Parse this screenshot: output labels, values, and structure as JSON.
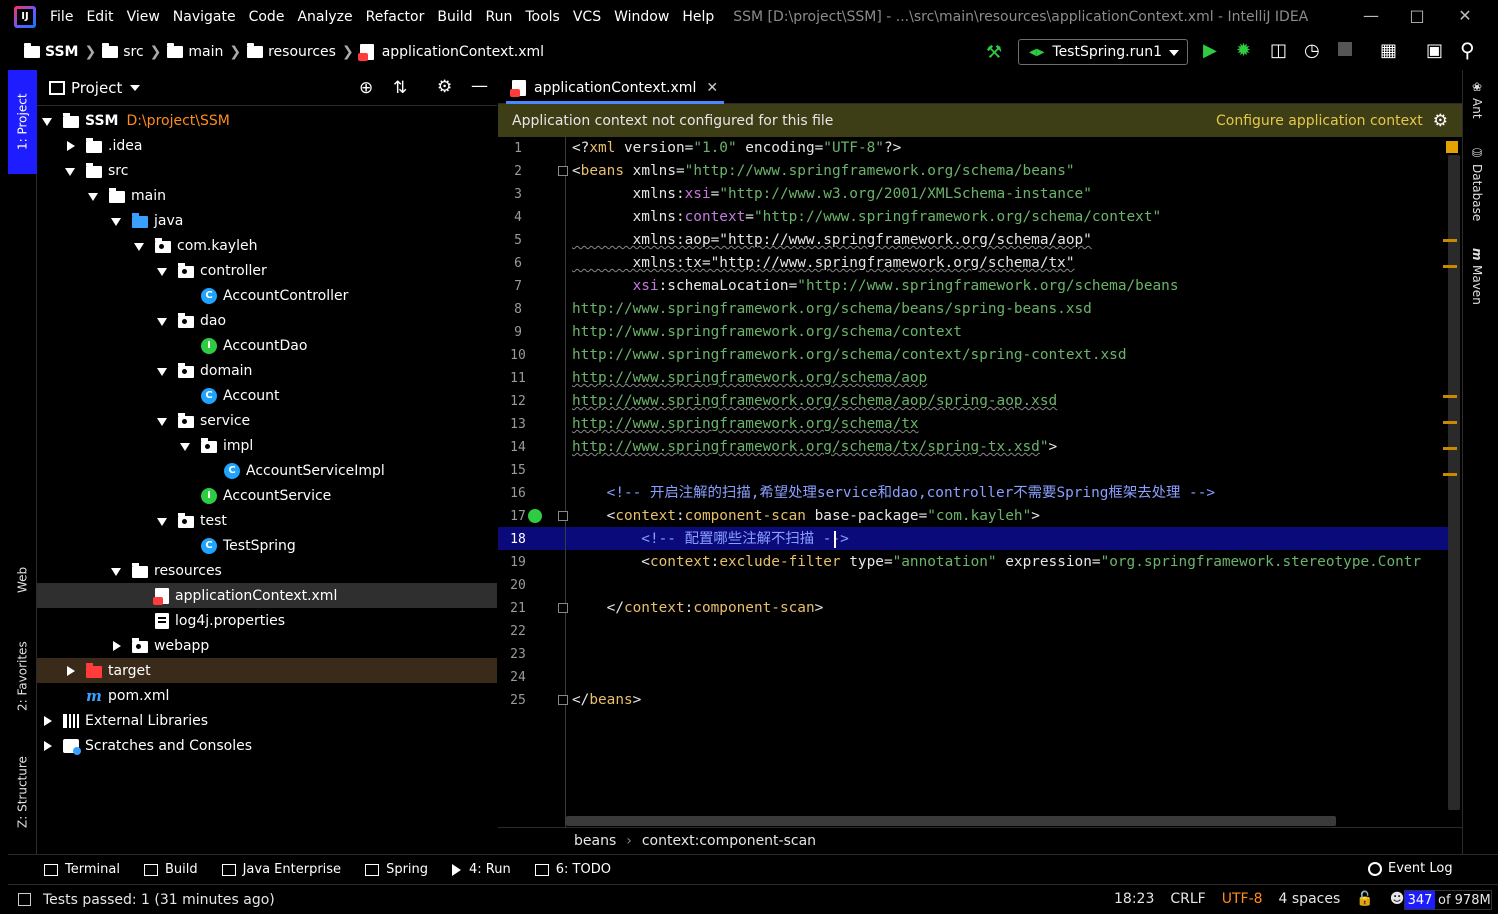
{
  "menubar": {
    "items": [
      "File",
      "Edit",
      "View",
      "Navigate",
      "Code",
      "Analyze",
      "Refactor",
      "Build",
      "Run",
      "Tools",
      "VCS",
      "Window",
      "Help"
    ],
    "window_title": "SSM [D:\\project\\SSM] - ...\\src\\main\\resources\\applicationContext.xml - IntelliJ IDEA"
  },
  "navbar": {
    "crumbs": [
      "SSM",
      "src",
      "main",
      "resources",
      "applicationContext.xml"
    ],
    "run_config": "TestSpring.run1"
  },
  "left_strip": {
    "tabs": [
      "1: Project",
      "Web",
      "2: Favorites",
      "Z: Structure"
    ]
  },
  "project_panel": {
    "title": "Project",
    "tree": [
      {
        "label": "SSM",
        "hint": "D:\\project\\SSM",
        "icon": "module-folder-icon",
        "depth": 0,
        "toggle": "open"
      },
      {
        "label": ".idea",
        "icon": "folder-icon",
        "depth": 1,
        "toggle": "closed"
      },
      {
        "label": "src",
        "icon": "folder-icon",
        "depth": 1,
        "toggle": "open"
      },
      {
        "label": "main",
        "icon": "folder-icon",
        "depth": 2,
        "toggle": "open"
      },
      {
        "label": "java",
        "icon": "source-folder-icon",
        "depth": 3,
        "toggle": "open"
      },
      {
        "label": "com.kayleh",
        "icon": "package-icon",
        "depth": 4,
        "toggle": "open"
      },
      {
        "label": "controller",
        "icon": "package-icon",
        "depth": 5,
        "toggle": "open"
      },
      {
        "label": "AccountController",
        "icon": "class-icon",
        "depth": 6,
        "toggle": "none"
      },
      {
        "label": "dao",
        "icon": "package-icon",
        "depth": 5,
        "toggle": "open"
      },
      {
        "label": "AccountDao",
        "icon": "interface-icon",
        "depth": 6,
        "toggle": "none"
      },
      {
        "label": "domain",
        "icon": "package-icon",
        "depth": 5,
        "toggle": "open"
      },
      {
        "label": "Account",
        "icon": "class-icon",
        "depth": 6,
        "toggle": "none"
      },
      {
        "label": "service",
        "icon": "package-icon",
        "depth": 5,
        "toggle": "open"
      },
      {
        "label": "impl",
        "icon": "package-icon",
        "depth": 6,
        "toggle": "open"
      },
      {
        "label": "AccountServiceImpl",
        "icon": "class-icon",
        "depth": 7,
        "toggle": "none"
      },
      {
        "label": "AccountService",
        "icon": "interface-icon",
        "depth": 6,
        "toggle": "none"
      },
      {
        "label": "test",
        "icon": "package-icon",
        "depth": 5,
        "toggle": "open"
      },
      {
        "label": "TestSpring",
        "icon": "class-icon",
        "depth": 6,
        "toggle": "none"
      },
      {
        "label": "resources",
        "icon": "resources-folder-icon",
        "depth": 3,
        "toggle": "open"
      },
      {
        "label": "applicationContext.xml",
        "icon": "xml-file-icon",
        "depth": 4,
        "toggle": "none",
        "selected": true
      },
      {
        "label": "log4j.properties",
        "icon": "properties-file-icon",
        "depth": 4,
        "toggle": "none"
      },
      {
        "label": "webapp",
        "icon": "web-folder-icon",
        "depth": 3,
        "toggle": "closed"
      },
      {
        "label": "target",
        "icon": "excluded-folder-icon",
        "depth": 1,
        "toggle": "closed",
        "excluded": true
      },
      {
        "label": "pom.xml",
        "icon": "maven-icon",
        "depth": 1,
        "toggle": "none"
      },
      {
        "label": "External Libraries",
        "icon": "library-icon",
        "depth": 0,
        "toggle": "closed"
      },
      {
        "label": "Scratches and Consoles",
        "icon": "scratch-icon",
        "depth": 0,
        "toggle": "closed"
      }
    ]
  },
  "editor": {
    "tab_label": "applicationContext.xml",
    "banner_message": "Application context not configured for this file",
    "banner_link": "Configure application context",
    "current_line": 18,
    "lines": [
      [
        [
          "pun",
          "<?"
        ],
        [
          "tag",
          "xml"
        ],
        [
          "attr",
          " version"
        ],
        [
          "pun",
          "="
        ],
        [
          "val",
          "\"1.0\""
        ],
        [
          "attr",
          " encoding"
        ],
        [
          "pun",
          "="
        ],
        [
          "val",
          "\"UTF-8\""
        ],
        [
          "pun",
          "?>"
        ]
      ],
      [
        [
          "pun",
          "<"
        ],
        [
          "tag",
          "beans"
        ],
        [
          "attr",
          " xmlns"
        ],
        [
          "pun",
          "="
        ],
        [
          "val",
          "\"http://www.springframework.org/schema/beans\""
        ]
      ],
      [
        [
          "attr",
          "       xmlns:"
        ],
        [
          "ns",
          "xsi"
        ],
        [
          "pun",
          "="
        ],
        [
          "val",
          "\"http://www.w3.org/2001/XMLSchema-instance\""
        ]
      ],
      [
        [
          "attr",
          "       xmlns:"
        ],
        [
          "ns",
          "context"
        ],
        [
          "pun",
          "="
        ],
        [
          "val",
          "\"http://www.springframework.org/schema/context\""
        ]
      ],
      [
        [
          "uw",
          "       xmlns:aop=\"http://www.springframework.org/schema/aop\""
        ]
      ],
      [
        [
          "uw",
          "       xmlns:tx=\"http://www.springframework.org/schema/tx\""
        ]
      ],
      [
        [
          "ns",
          "       xsi"
        ],
        [
          "attr",
          ":schemaLocation"
        ],
        [
          "pun",
          "="
        ],
        [
          "val",
          "\"http://www.springframework.org/schema/beans"
        ]
      ],
      [
        [
          "url",
          "http://www.springframework.org/schema/beans/spring-beans.xsd"
        ]
      ],
      [
        [
          "url",
          "http://www.springframework.org/schema/context"
        ]
      ],
      [
        [
          "url",
          "http://www.springframework.org/schema/context/spring-context.xsd"
        ]
      ],
      [
        [
          "uwv",
          "http://www.springframework.org/schema/aop"
        ]
      ],
      [
        [
          "uwv",
          "http://www.springframework.org/schema/aop/spring-aop.xsd"
        ]
      ],
      [
        [
          "uwv",
          "http://www.springframework.org/schema/tx"
        ]
      ],
      [
        [
          "uwv",
          "http://www.springframework.org/schema/tx/spring-tx.xsd"
        ],
        [
          "val",
          "\""
        ],
        [
          "pun",
          ">"
        ]
      ],
      [],
      [
        [
          "com",
          "    <!-- 开启注解的扫描,希望处理service和dao,controller不需要Spring框架去处理 -->"
        ]
      ],
      [
        [
          "pun",
          "    <"
        ],
        [
          "tag",
          "context"
        ],
        [
          "pun",
          ":"
        ],
        [
          "tag",
          "component-scan"
        ],
        [
          "attr",
          " base-package"
        ],
        [
          "pun",
          "="
        ],
        [
          "val",
          "\"com.kayleh\""
        ],
        [
          "pun",
          ">"
        ]
      ],
      [
        [
          "com",
          "        <!-- 配置哪些注解不扫描 -->"
        ]
      ],
      [
        [
          "pun",
          "        <"
        ],
        [
          "tag",
          "context"
        ],
        [
          "pun",
          ":"
        ],
        [
          "tag",
          "exclude-filter"
        ],
        [
          "attr",
          " type"
        ],
        [
          "pun",
          "="
        ],
        [
          "val",
          "\"annotation\""
        ],
        [
          "attr",
          " expression"
        ],
        [
          "pun",
          "="
        ],
        [
          "val",
          "\"org.springframework.stereotype.Contr"
        ]
      ],
      [],
      [
        [
          "pun",
          "    </"
        ],
        [
          "tag",
          "context"
        ],
        [
          "pun",
          ":"
        ],
        [
          "tag",
          "component-scan"
        ],
        [
          "pun",
          ">"
        ]
      ],
      [],
      [],
      [],
      [
        [
          "pun",
          "</"
        ],
        [
          "tag",
          "beans"
        ],
        [
          "pun",
          ">"
        ]
      ]
    ],
    "breadcrumbs": [
      "beans",
      "context:component-scan"
    ]
  },
  "right_strip": {
    "tabs": [
      "Ant",
      "Database",
      "Maven"
    ]
  },
  "bottom_tools": [
    "Terminal",
    "Build",
    "Java Enterprise",
    "Spring",
    "4: Run",
    "6: TODO"
  ],
  "event_log": "Event Log",
  "statusbar": {
    "message": "Tests passed: 1 (31 minutes ago)",
    "position": "18:23",
    "line_sep": "CRLF",
    "encoding": "UTF-8",
    "indent": "4 spaces",
    "memory_used": "347",
    "memory_total": "of 978M"
  }
}
